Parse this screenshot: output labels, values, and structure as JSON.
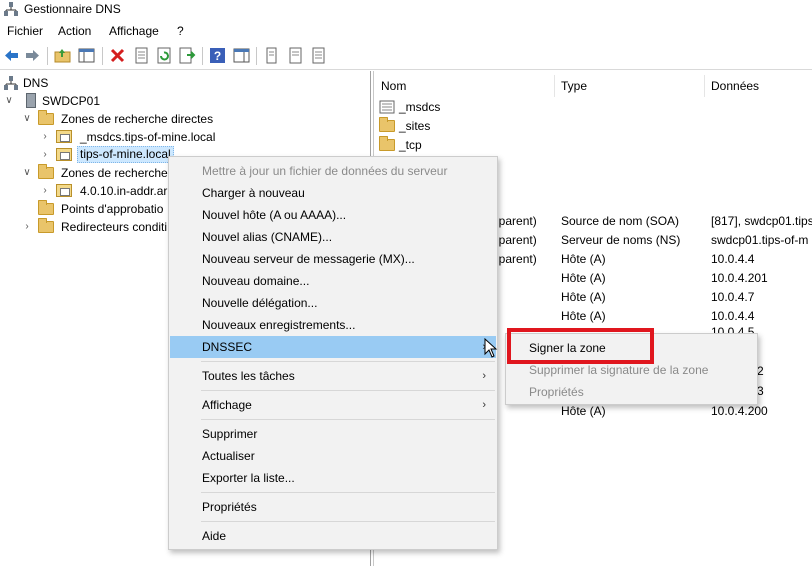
{
  "window": {
    "title": "Gestionnaire DNS",
    "icon": "dns-manager-icon"
  },
  "menubar": {
    "items": [
      "Fichier",
      "Action",
      "Affichage",
      "?"
    ]
  },
  "toolbar": {
    "buttons": [
      "back-icon",
      "forward-icon",
      "up-folder-icon",
      "show-hide-tree-icon",
      "delete-icon",
      "properties-icon",
      "refresh-icon",
      "export-icon",
      "help-icon",
      "console-icon",
      "record-icon",
      "record-alt-icon"
    ]
  },
  "tree": {
    "root": "DNS",
    "server": "SWDCP01",
    "forward_zones": "Zones de recherche directes",
    "zone1": "_msdcs.tips-of-mine.local",
    "zone2": "tips-of-mine.local",
    "reverse_zones": "Zones de recherche",
    "reverse_zone1": "4.0.10.in-addr.ar",
    "trust_points": "Points d'approbatio",
    "forwarders": "Redirecteurs conditi"
  },
  "list": {
    "columns": [
      "Nom",
      "Type",
      "Données"
    ],
    "folders": [
      "_msdcs",
      "_sites",
      "_tcp"
    ],
    "rows": [
      {
        "name": "ier parent)",
        "type": "Source de nom (SOA)",
        "data": "[817], swdcp01.tips"
      },
      {
        "name": "ier parent)",
        "type": "Serveur de noms (NS)",
        "data": "swdcp01.tips-of-m"
      },
      {
        "name": "ier parent)",
        "type": "Hôte (A)",
        "data": "10.0.4.4"
      },
      {
        "name": "",
        "type": "Hôte (A)",
        "data": "10.0.4.201"
      },
      {
        "name": "",
        "type": "Hôte (A)",
        "data": "10.0.4.7"
      },
      {
        "name": "",
        "type": "Hôte (A)",
        "data": "10.0.4.4"
      },
      {
        "name": "",
        "type": "Hôte (A)",
        "data": "10.0.4.200"
      }
    ],
    "partial": {
      "r1": "10.0.4.5",
      "r2": "2",
      "r3": "3"
    }
  },
  "context_menu": {
    "items": [
      {
        "label": "Mettre à jour un fichier de données du serveur",
        "disabled": true
      },
      {
        "label": "Charger à nouveau"
      },
      {
        "label": "Nouvel hôte (A ou AAAA)..."
      },
      {
        "label": "Nouvel alias (CNAME)..."
      },
      {
        "label": "Nouveau serveur de messagerie (MX)..."
      },
      {
        "label": "Nouveau domaine..."
      },
      {
        "label": "Nouvelle délégation..."
      },
      {
        "label": "Nouveaux enregistrements..."
      },
      {
        "label": "DNSSEC",
        "submenu": true,
        "highlighted": true
      },
      {
        "label": "Toutes les tâches",
        "submenu": true
      },
      {
        "label": "Affichage",
        "submenu": true
      },
      {
        "label": "Supprimer"
      },
      {
        "label": "Actualiser"
      },
      {
        "label": "Exporter la liste..."
      },
      {
        "label": "Propriétés"
      },
      {
        "label": "Aide"
      }
    ]
  },
  "dnssec_submenu": {
    "items": [
      {
        "label": "Signer la zone"
      },
      {
        "label": "Supprimer la signature de la zone",
        "disabled": true
      },
      {
        "label": "Propriétés",
        "disabled": true
      }
    ]
  },
  "colors": {
    "highlight": "#99cbf3",
    "callout": "#e0161e",
    "selected_node": "#cde8ff"
  }
}
